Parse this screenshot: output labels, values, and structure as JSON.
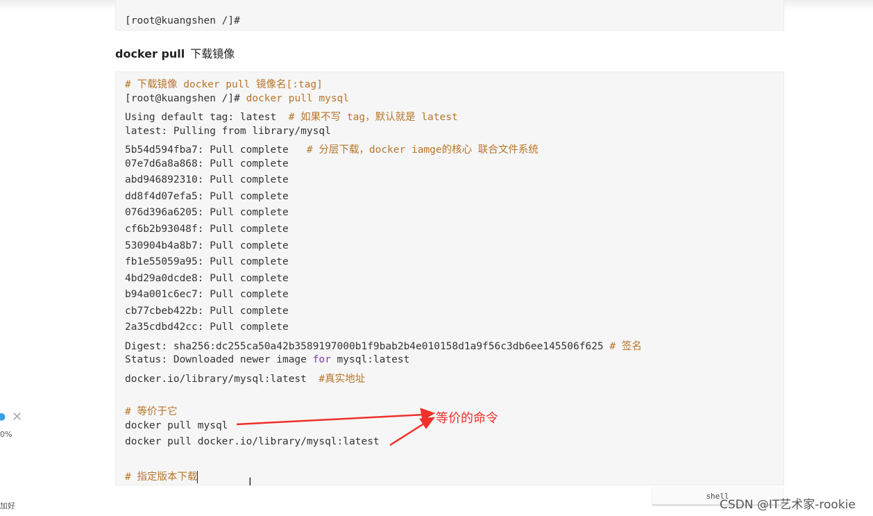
{
  "top_block": {
    "text": "[root@kuangshen /]#"
  },
  "heading": {
    "command": "docker pull",
    "desc": "下载镜像"
  },
  "code_lines": [
    [
      {
        "t": "# 下载镜像 docker pull 镜像名[:tag]",
        "c": "comment"
      }
    ],
    [
      {
        "t": "[root@kuangshen /]# ",
        "c": "plain"
      },
      {
        "t": "docker pull mysql",
        "c": "comment"
      }
    ],
    [
      {
        "t": "Using default tag: latest  ",
        "c": "plain"
      },
      {
        "t": "# 如果不写 tag，默认就是 latest",
        "c": "comment"
      }
    ],
    [
      {
        "t": "latest: Pulling from library/mysql",
        "c": "plain"
      }
    ],
    [
      {
        "t": "5b54d594fba7: Pull complete   ",
        "c": "plain"
      },
      {
        "t": "# 分层下载，docker iamge的核心 联合文件系统",
        "c": "comment"
      }
    ],
    [
      {
        "t": "07e7d6a8a868: Pull complete",
        "c": "plain"
      }
    ],
    [
      {
        "t": "abd946892310: Pull complete",
        "c": "plain"
      }
    ],
    [
      {
        "t": "dd8f4d07efa5: Pull complete",
        "c": "plain"
      }
    ],
    [
      {
        "t": "076d396a6205: Pull complete",
        "c": "plain"
      }
    ],
    [
      {
        "t": "cf6b2b93048f: Pull complete",
        "c": "plain"
      }
    ],
    [
      {
        "t": "530904b4a8b7: Pull complete",
        "c": "plain"
      }
    ],
    [
      {
        "t": "fb1e55059a95: Pull complete",
        "c": "plain"
      }
    ],
    [
      {
        "t": "4bd29a0dcde8: Pull complete",
        "c": "plain"
      }
    ],
    [
      {
        "t": "b94a001c6ec7: Pull complete",
        "c": "plain"
      }
    ],
    [
      {
        "t": "cb77cbeb422b: Pull complete",
        "c": "plain"
      }
    ],
    [
      {
        "t": "2a35cdbd42cc: Pull complete",
        "c": "plain"
      }
    ],
    [
      {
        "t": "Digest: sha256:dc255ca50a42b3589197000b1f9bab2b4e010158d1a9f56c3db6ee145506f625 ",
        "c": "plain"
      },
      {
        "t": "# 签名",
        "c": "comment"
      }
    ],
    [
      {
        "t": "Status: Downloaded newer image ",
        "c": "plain"
      },
      {
        "t": "for",
        "c": "keyword"
      },
      {
        "t": " mysql:latest",
        "c": "plain"
      }
    ],
    [
      {
        "t": "docker.io/library/mysql:latest  ",
        "c": "plain"
      },
      {
        "t": "#真实地址",
        "c": "comment"
      }
    ],
    [],
    [
      {
        "t": "# 等价于它",
        "c": "comment"
      }
    ],
    [
      {
        "t": "docker pull mysql",
        "c": "plain"
      }
    ],
    [
      {
        "t": "docker pull docker.io/library/mysql:latest",
        "c": "plain"
      }
    ],
    [],
    [
      {
        "t": "# 指定版本下载",
        "c": "comment"
      }
    ]
  ],
  "annotation": "等价的命令",
  "code_language": "shell",
  "watermark": "CSDN @IT艺术家-rookie",
  "sidebar": {
    "percent": "0%",
    "text": "加好"
  },
  "colors": {
    "comment": "#b8752a",
    "keyword": "#7a3e9d",
    "arrow": "#f0302a",
    "code_bg": "#f6f6f6"
  }
}
